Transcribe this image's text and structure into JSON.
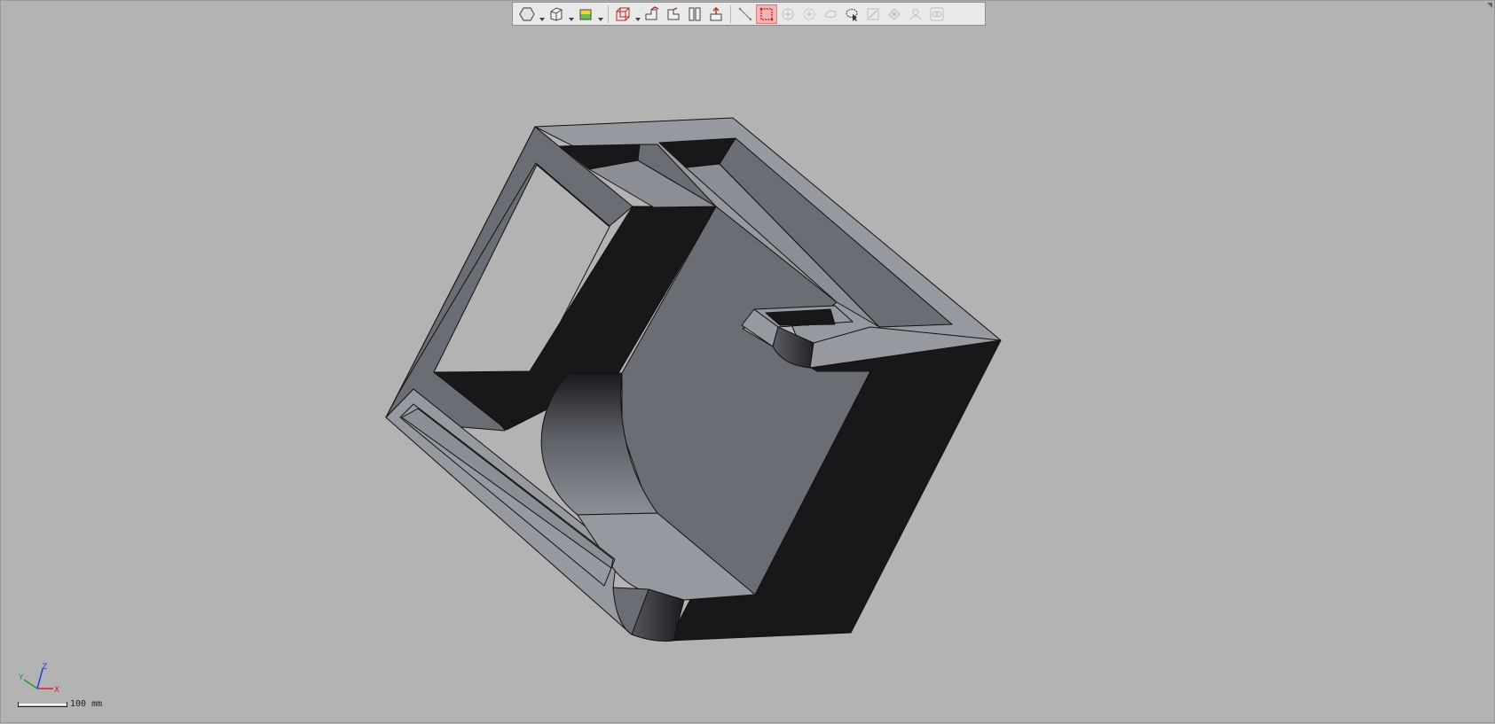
{
  "viewport": {
    "background": "#b3b3b3"
  },
  "toolbar": {
    "items": [
      {
        "name": "view-style-icon",
        "type": "button",
        "dropdown": true
      },
      {
        "name": "standard-views-icon",
        "type": "button",
        "dropdown": true
      },
      {
        "name": "shading-icon",
        "type": "button",
        "dropdown": true
      },
      {
        "name": "wireframe-box-icon",
        "type": "button",
        "dropdown": true
      },
      {
        "name": "section-view-icon",
        "type": "button"
      },
      {
        "name": "section-view-alt-icon",
        "type": "button"
      },
      {
        "name": "split-view-icon",
        "type": "button"
      },
      {
        "name": "explode-icon",
        "type": "button"
      },
      {
        "name": "measure-distance-icon",
        "type": "button"
      },
      {
        "name": "box-select-icon",
        "type": "button",
        "active": true
      },
      {
        "name": "add-point-icon",
        "type": "button",
        "disabled": true
      },
      {
        "name": "add-point-alt-icon",
        "type": "button",
        "disabled": true
      },
      {
        "name": "lasso-select-icon",
        "type": "button",
        "disabled": true
      },
      {
        "name": "lasso-cursor-icon",
        "type": "button"
      },
      {
        "name": "edit-icon",
        "type": "button",
        "disabled": true
      },
      {
        "name": "markup-icon",
        "type": "button",
        "disabled": true
      },
      {
        "name": "pan-icon",
        "type": "button",
        "disabled": true
      },
      {
        "name": "visibility-icon",
        "type": "button",
        "disabled": true
      }
    ]
  },
  "axis_triad": {
    "x_label": "X",
    "y_label": "Y",
    "z_label": "Z",
    "x_color": "#e02020",
    "y_color": "#20a020",
    "z_color": "#2040e0"
  },
  "scale": {
    "label": "100 mm"
  },
  "model": {
    "light_face": "#9799a0",
    "mid_face": "#6a6d74",
    "dark_face": "#18181b",
    "edge": "#111111"
  }
}
